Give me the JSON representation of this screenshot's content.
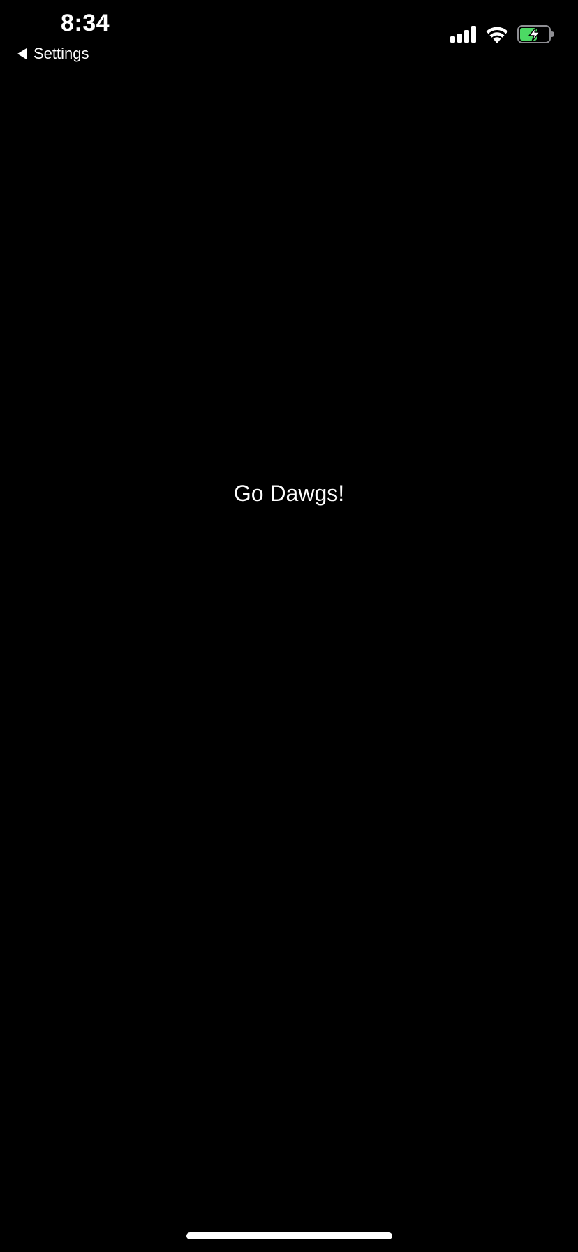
{
  "status_bar": {
    "time": "8:34",
    "back_label": "Settings",
    "icons": [
      "back-arrow-icon",
      "cellular-signal-icon",
      "wifi-icon",
      "battery-charging-icon"
    ],
    "battery_color": "#4cd964"
  },
  "main": {
    "message": "Go Dawgs!"
  },
  "colors": {
    "background": "#000000",
    "text": "#ffffff"
  }
}
